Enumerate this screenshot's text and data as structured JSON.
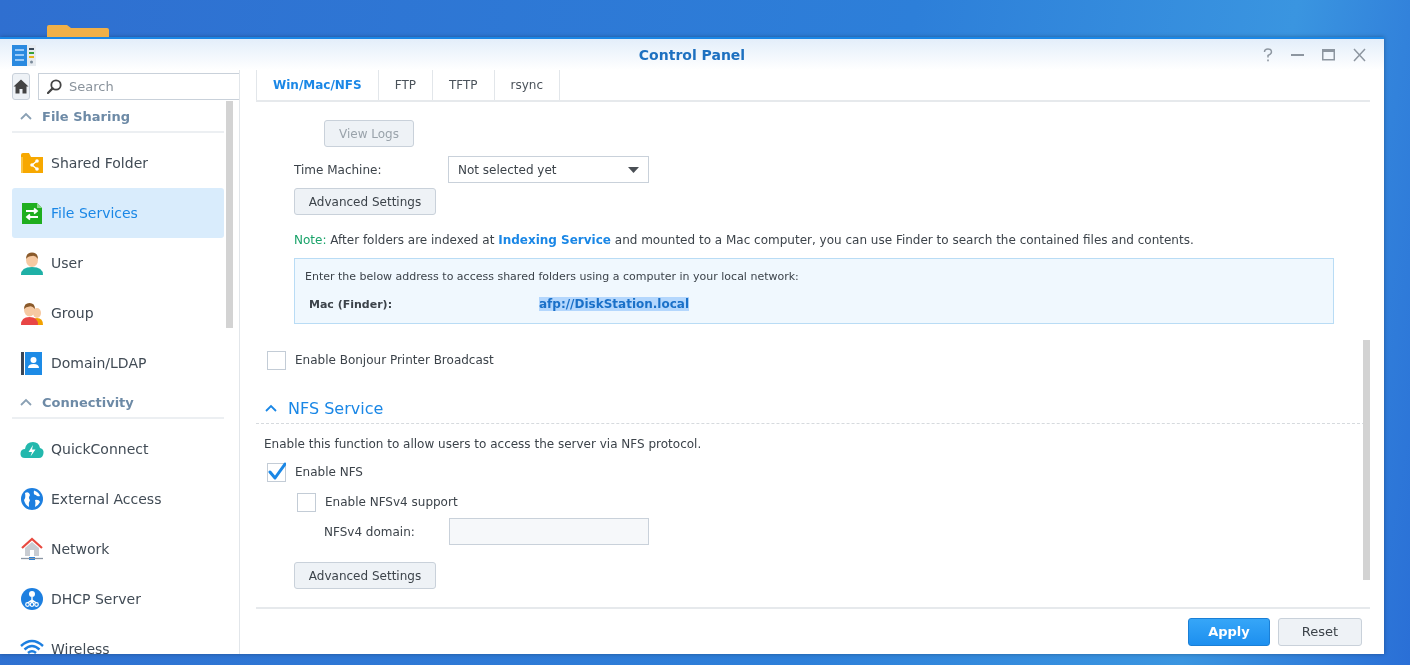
{
  "window": {
    "title": "Control Panel"
  },
  "sidebar": {
    "search": {
      "placeholder": "Search"
    },
    "sections": [
      {
        "title": "File Sharing",
        "expanded": true,
        "items": [
          {
            "label": "Shared Folder",
            "selected": false
          },
          {
            "label": "File Services",
            "selected": true
          },
          {
            "label": "User",
            "selected": false
          },
          {
            "label": "Group",
            "selected": false
          },
          {
            "label": "Domain/LDAP",
            "selected": false
          }
        ]
      },
      {
        "title": "Connectivity",
        "expanded": true,
        "items": [
          {
            "label": "QuickConnect",
            "selected": false
          },
          {
            "label": "External Access",
            "selected": false
          },
          {
            "label": "Network",
            "selected": false
          },
          {
            "label": "DHCP Server",
            "selected": false
          },
          {
            "label": "Wireless",
            "selected": false
          }
        ]
      }
    ]
  },
  "tabs": [
    {
      "label": "Win/Mac/NFS",
      "selected": true
    },
    {
      "label": "FTP",
      "selected": false
    },
    {
      "label": "TFTP",
      "selected": false
    },
    {
      "label": "rsync",
      "selected": false
    }
  ],
  "panel": {
    "view_logs": {
      "label": "View Logs",
      "disabled": true
    },
    "time_machine": {
      "label": "Time Machine:",
      "value": "Not selected yet"
    },
    "afp_advanced": {
      "label": "Advanced Settings"
    },
    "note": {
      "label": "Note:",
      "before": "After folders are indexed at ",
      "link": "Indexing Service",
      "after": " and mounted to a Mac computer, you can use Finder to search the contained files and contents."
    },
    "address_box": {
      "intro": "Enter the below address to access shared folders using a computer in your local network:",
      "label": "Mac (Finder):",
      "value": "afp://DiskStation.local",
      "highlighted": true
    },
    "bonjour": {
      "label": "Enable Bonjour Printer Broadcast",
      "checked": false
    },
    "nfs": {
      "title": "NFS Service",
      "expanded": true,
      "description": "Enable this function to allow users to access the server via NFS protocol.",
      "enable_nfs": {
        "label": "Enable NFS",
        "checked": true
      },
      "nfsv4": {
        "label": "Enable NFSv4 support",
        "checked": false
      },
      "domain": {
        "label": "NFSv4 domain:"
      },
      "advanced": {
        "label": "Advanced Settings"
      }
    }
  },
  "footer": {
    "buttons": [
      {
        "label": "Apply",
        "kind": "primary"
      },
      {
        "label": "Reset",
        "kind": "secondary"
      }
    ]
  }
}
